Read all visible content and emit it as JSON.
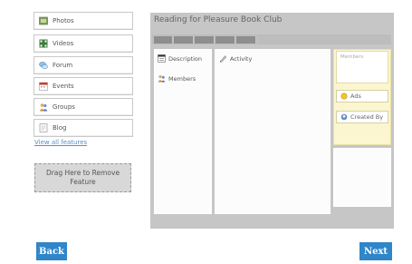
{
  "features": [
    {
      "label": "Photos",
      "icon": "photos-icon"
    },
    {
      "label": "Videos",
      "icon": "videos-icon"
    },
    {
      "label": "Forum",
      "icon": "forum-icon"
    },
    {
      "label": "Events",
      "icon": "events-icon"
    },
    {
      "label": "Groups",
      "icon": "groups-icon"
    },
    {
      "label": "Blog",
      "icon": "blog-icon"
    }
  ],
  "view_all": "View all features",
  "drop_zone": {
    "line1": "Drag Here to Remove",
    "line2": "Feature"
  },
  "page": {
    "title": "Reading for Pleasure Book Club",
    "left_column": {
      "description": "Description",
      "members": "Members"
    },
    "center_column": {
      "activity": "Activity"
    },
    "right_column": {
      "members_label": "Members",
      "ads": "Ads",
      "created_by": "Created By"
    }
  },
  "nav": {
    "back": "Back",
    "next": "Next"
  },
  "colors": {
    "accent": "#2f86c8",
    "panel": "#c6c6c6",
    "tab": "#8e8e8e",
    "highlight": "#fbf6cf",
    "link": "#5a8fc9"
  }
}
